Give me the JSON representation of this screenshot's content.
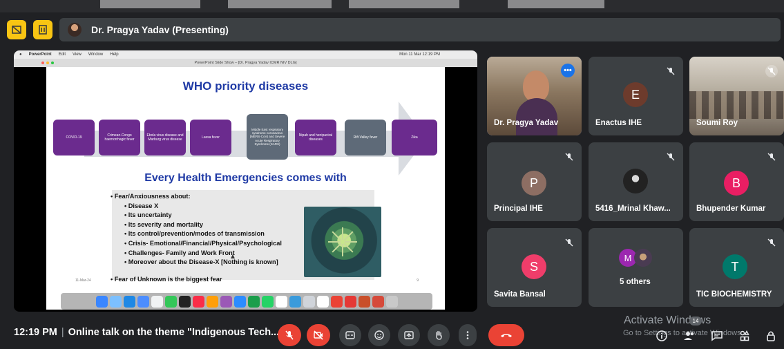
{
  "presenter_bar": {
    "title": "Dr. Pragya Yadav (Presenting)",
    "colors": {
      "button_bg": "#f9c513",
      "pill_bg": "#3c4043"
    }
  },
  "shared_screen": {
    "menu_bar": [
      "PowerPoint",
      "Edit",
      "View",
      "Window",
      "Help"
    ],
    "menu_right": "Mon 11 Mar 12:19 PM",
    "window_title": "PowerPoint Slide Show – [Dr. Pragya Yadav ICMR NIV DLG]",
    "slide": {
      "title": "WHO priority diseases",
      "diseases": [
        "COVID-19",
        "Crimean-Congo haemorrhagic fever",
        "Ebola virus disease and Marburg virus disease",
        "Lassa fever",
        "Middle East respiratory syndrome coronavirus (MERS-CoV) and Severe Acute Respiratory Syndrome (SARS)",
        "Nipah and henipaviral diseases",
        "Rift Valley fever",
        "Zika"
      ],
      "subtitle": "Every Health Emergencies comes with",
      "bullet_main": "Fear/Anxiousness about:",
      "sub_bullets": [
        "Disease X",
        "Its uncertainty",
        "Its severity and mortality",
        "Its control/prevention/modes of transmission",
        "Crisis- Emotional/Financial/Physical/Psychological",
        "Challenges- Family and Work Front",
        "Moreover about the Disease-X [Nothing is known]"
      ],
      "bullet_last": "Fear of Unknown is the biggest fear",
      "date": "11-Mar-24",
      "page": "9"
    }
  },
  "participants": [
    {
      "name": "Dr. Pragya Yadav",
      "type": "video",
      "muted": false,
      "speaking": true
    },
    {
      "name": "Enactus IHE",
      "initial": "E",
      "avatar_color": "#6d3b2c",
      "muted": true
    },
    {
      "name": "Soumi Roy",
      "type": "video",
      "muted": true
    },
    {
      "name": "Principal IHE",
      "initial": "P",
      "avatar_color": "#8d6e63",
      "muted": true
    },
    {
      "name": "5416_Mrinal Khaw...",
      "type": "photo",
      "muted": true
    },
    {
      "name": "Bhupender Kumar",
      "initial": "B",
      "avatar_color": "#e91e63",
      "muted": true
    },
    {
      "name": "Savita Bansal",
      "initial": "S",
      "avatar_color": "#ef3d6a",
      "muted": true
    },
    {
      "name": "5 others",
      "initial": "M",
      "avatar_color": "#9c27b0",
      "muted": false
    },
    {
      "name": "TIC BIOCHEMISTRY",
      "initial": "T",
      "avatar_color": "#00796b",
      "muted": true
    }
  ],
  "bottom_bar": {
    "time": "12:19 PM",
    "separator": "|",
    "meeting_title": "Online talk on the theme \"Indigenous Tech...",
    "controls": [
      "mic-off-icon",
      "camera-off-icon",
      "captions-icon",
      "emoji-icon",
      "present-icon",
      "raise-hand-icon",
      "more-options-icon",
      "leave-call-icon"
    ],
    "people_count": "14",
    "colors": {
      "danger": "#ea4335",
      "control_bg": "#3c4043"
    }
  },
  "watermark": {
    "line1": "Activate Windows",
    "line2": "Go to Settings to activate Windows."
  }
}
